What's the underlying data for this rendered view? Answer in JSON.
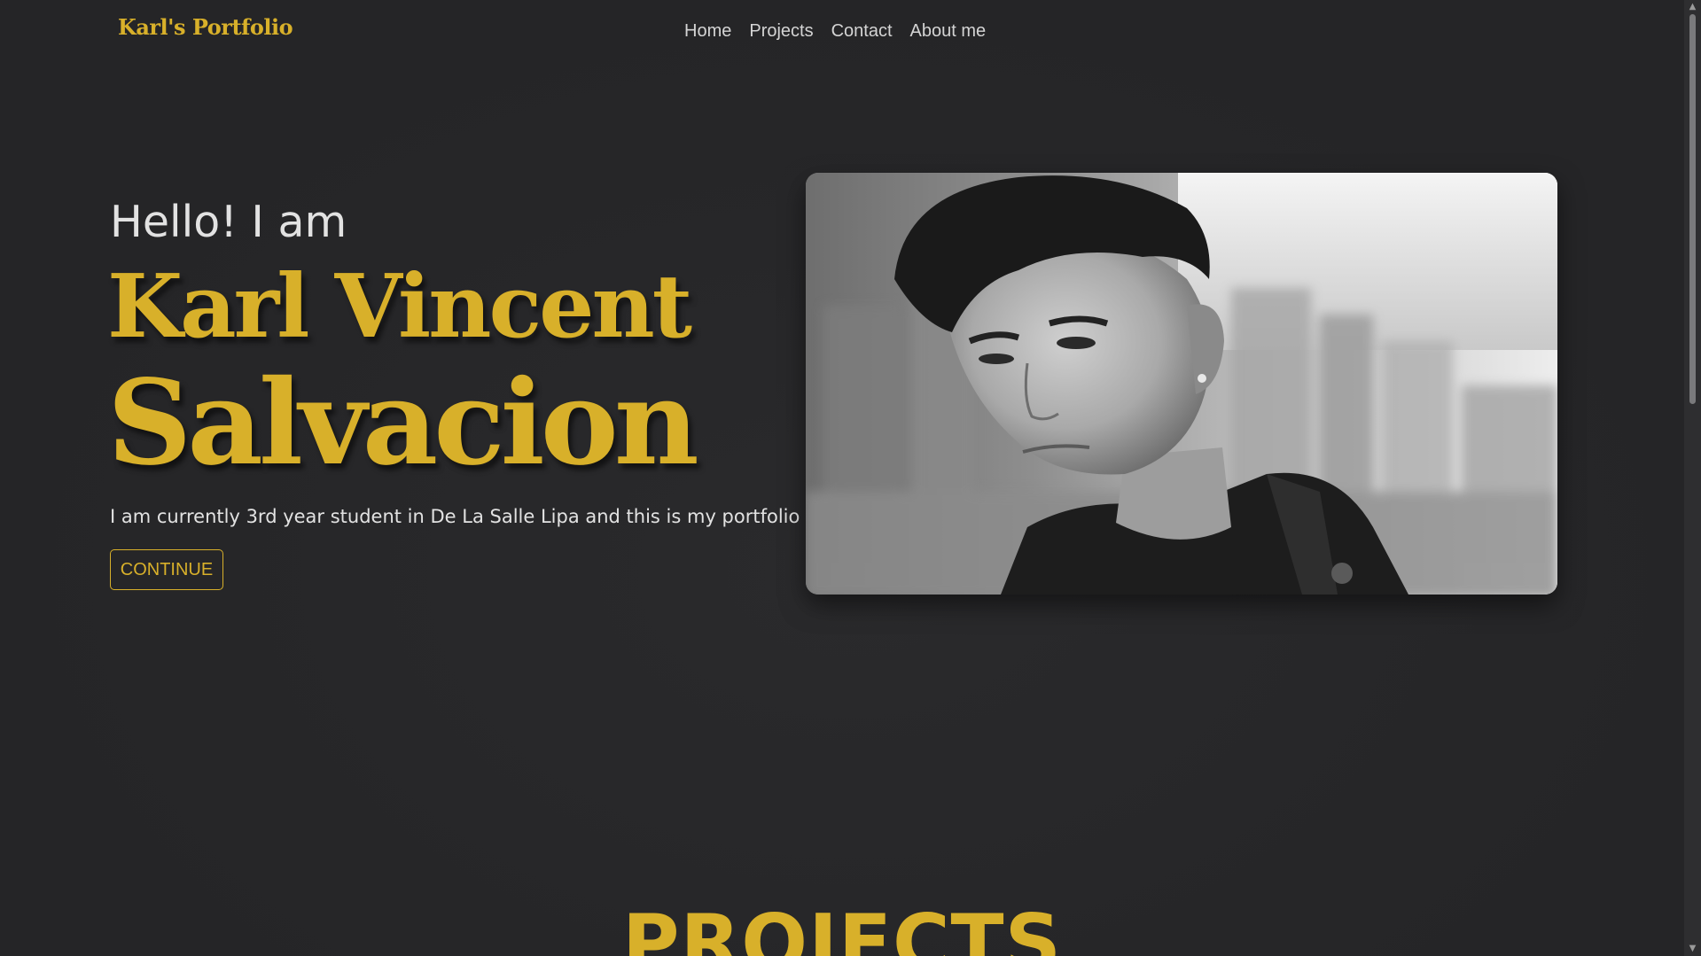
{
  "navbar": {
    "brand": "Karl's Portfolio",
    "links": [
      {
        "label": "Home"
      },
      {
        "label": "Projects"
      },
      {
        "label": "Contact"
      },
      {
        "label": "About me"
      }
    ]
  },
  "hero": {
    "greeting": "Hello! I am",
    "first_name": "Karl Vincent",
    "last_name": "Salvacion",
    "tagline": "I am currently 3rd year student in De La Salle Lipa and this is my portfolio",
    "button_label": "CONTINUE"
  },
  "projects": {
    "heading": "PROJECTS"
  },
  "scrollbar": {
    "up_icon": "chevron-up-icon",
    "down_icon": "chevron-down-icon"
  },
  "colors": {
    "accent": "#d8b02a",
    "background": "#262628",
    "text": "#e2e2e2"
  }
}
